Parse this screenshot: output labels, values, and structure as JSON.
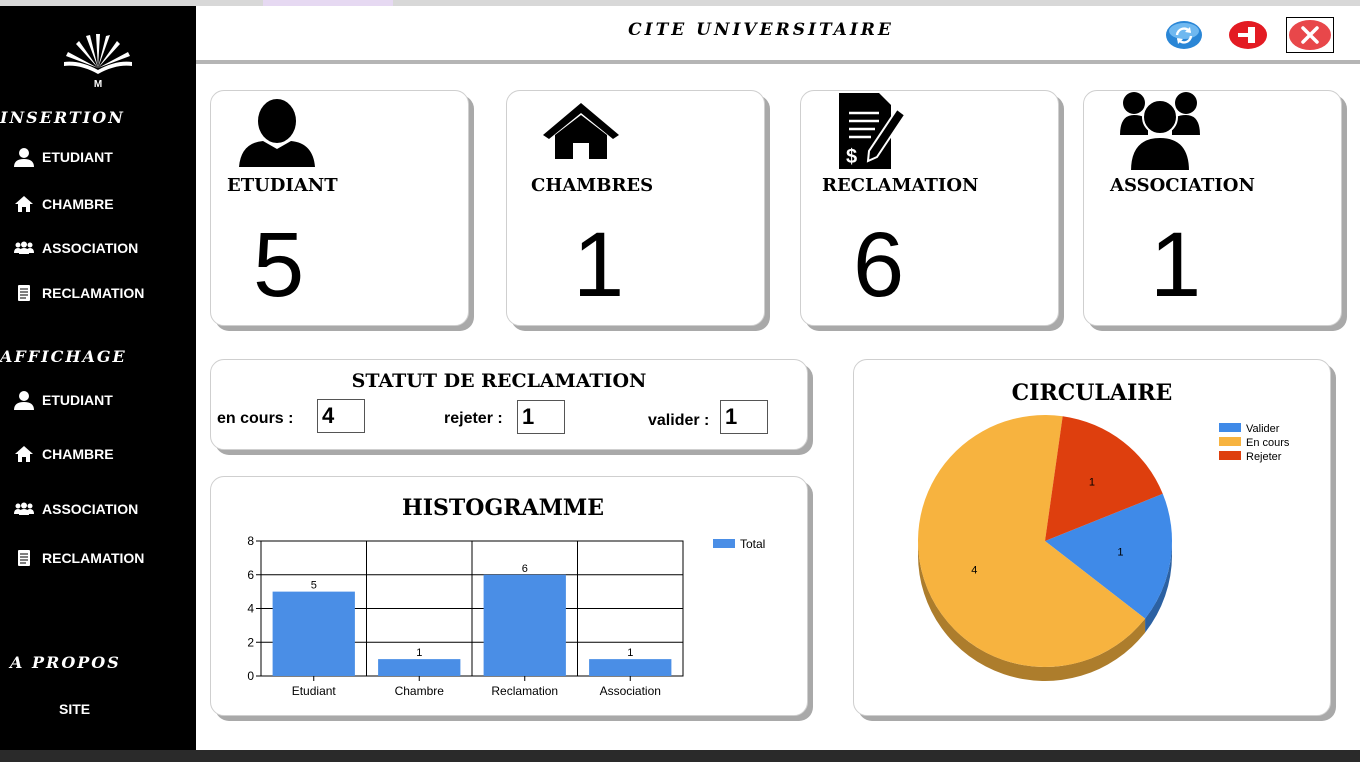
{
  "app": {
    "title": "CITE UNIVERSITAIRE"
  },
  "sidebar": {
    "logo_letter": "M",
    "insertion_title": "INSERTION",
    "insertion_items": [
      "ETUDIANT",
      "CHAMBRE",
      "ASSOCIATION",
      "RECLAMATION"
    ],
    "affichage_title": "AFFICHAGE",
    "affichage_items": [
      "ETUDIANT",
      "CHAMBRE",
      "ASSOCIATION",
      "RECLAMATION"
    ],
    "apropos_title": "A PROPOS",
    "site_label": "SITE"
  },
  "header_buttons": {
    "refresh": "refresh-icon",
    "logout": "logout-icon",
    "close": "close-icon"
  },
  "stats": [
    {
      "label": "ETUDIANT",
      "value": "5",
      "icon": "user-icon"
    },
    {
      "label": "CHAMBRES",
      "value": "1",
      "icon": "home-icon"
    },
    {
      "label": "RECLAMATION",
      "value": "6",
      "icon": "document-icon"
    },
    {
      "label": "ASSOCIATION",
      "value": "1",
      "icon": "group-icon"
    }
  ],
  "status": {
    "title": "STATUT DE RECLAMATION",
    "en_cours_label": "en cours :",
    "en_cours_value": "4",
    "rejeter_label": "rejeter :",
    "rejeter_value": "1",
    "valider_label": "valider :",
    "valider_value": "1"
  },
  "chart_data": [
    {
      "type": "bar",
      "title": "HISTOGRAMME",
      "categories": [
        "Etudiant",
        "Chambre",
        "Reclamation",
        "Association"
      ],
      "series": [
        {
          "name": "Total",
          "values": [
            5,
            1,
            6,
            1
          ],
          "color": "#4a8ee6"
        }
      ],
      "ylim": [
        0,
        8
      ],
      "yticks": [
        0,
        2,
        4,
        6,
        8
      ],
      "grid": true,
      "data_labels": true,
      "legend": "top-right"
    },
    {
      "type": "pie",
      "title": "CIRCULAIRE",
      "labels": [
        "Valider",
        "En cours",
        "Rejeter"
      ],
      "values": [
        1,
        4,
        1
      ],
      "colors": [
        "#3f8ae8",
        "#f7b33f",
        "#de3f0e"
      ],
      "data_labels": true,
      "legend": "top-right"
    }
  ]
}
